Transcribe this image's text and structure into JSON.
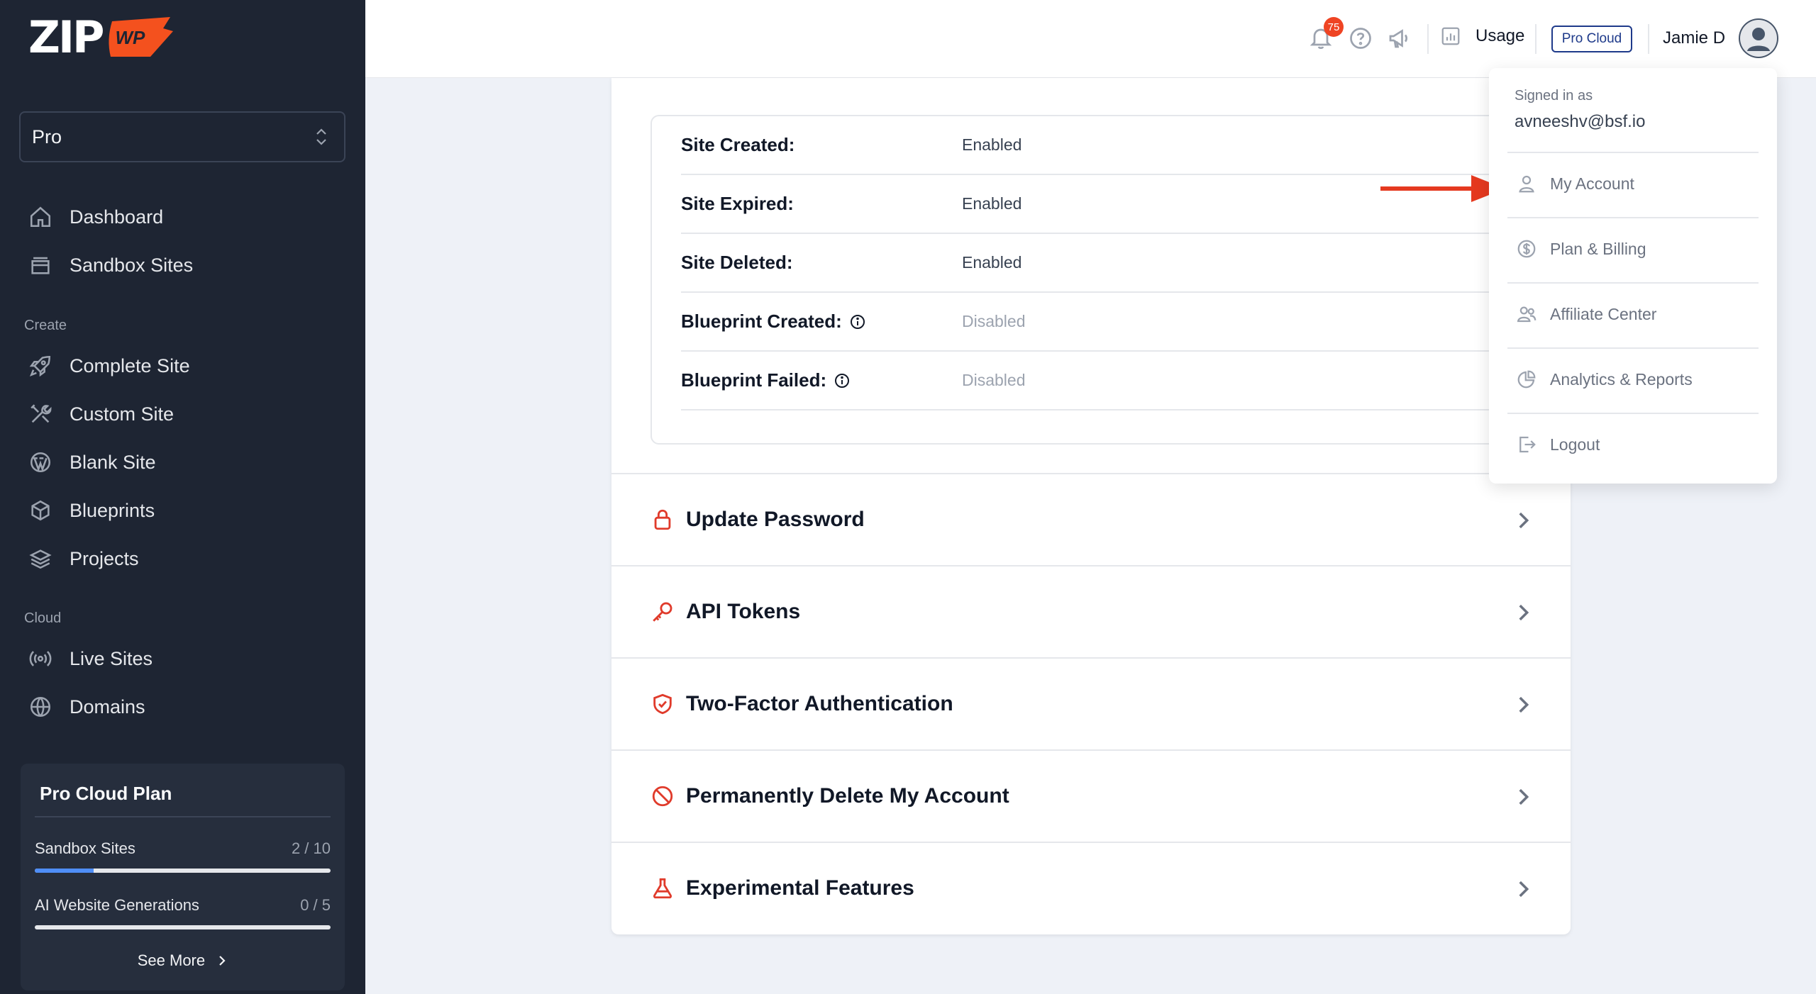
{
  "brand": {
    "logo_text": "ZIP",
    "logo_badge": "WP"
  },
  "sidebar": {
    "plan_select": "Pro",
    "nav_top": [
      {
        "label": "Dashboard",
        "icon": "home-icon"
      },
      {
        "label": "Sandbox Sites",
        "icon": "box-icon"
      }
    ],
    "section_create": "Create",
    "nav_create": [
      {
        "label": "Complete Site",
        "icon": "rocket-icon"
      },
      {
        "label": "Custom Site",
        "icon": "tools-icon"
      },
      {
        "label": "Blank Site",
        "icon": "wordpress-icon"
      },
      {
        "label": "Blueprints",
        "icon": "cube-icon"
      },
      {
        "label": "Projects",
        "icon": "layers-icon"
      }
    ],
    "section_cloud": "Cloud",
    "nav_cloud": [
      {
        "label": "Live Sites",
        "icon": "broadcast-icon"
      },
      {
        "label": "Domains",
        "icon": "globe-icon"
      }
    ],
    "plan_card": {
      "title": "Pro Cloud Plan",
      "usage": [
        {
          "label": "Sandbox Sites",
          "count": "2 / 10",
          "fraction": 0.2
        },
        {
          "label": "AI Website Generations",
          "count": "0 / 5",
          "fraction": 0
        }
      ],
      "see_more": "See More"
    }
  },
  "topbar": {
    "notifications_count": "75",
    "usage_label": "Usage",
    "plan_badge": "Pro Cloud",
    "user_name": "Jamie D"
  },
  "notifications": [
    {
      "label": "Site Created:",
      "value": "Enabled",
      "info": false,
      "enabled": true
    },
    {
      "label": "Site Expired:",
      "value": "Enabled",
      "info": false,
      "enabled": true
    },
    {
      "label": "Site Deleted:",
      "value": "Enabled",
      "info": false,
      "enabled": true
    },
    {
      "label": "Blueprint Created:",
      "value": "Disabled",
      "info": true,
      "enabled": false
    },
    {
      "label": "Blueprint Failed:",
      "value": "Disabled",
      "info": true,
      "enabled": false
    }
  ],
  "sections": [
    {
      "label": "Update Password",
      "icon": "lock-icon"
    },
    {
      "label": "API Tokens",
      "icon": "key-icon"
    },
    {
      "label": "Two-Factor Authentication",
      "icon": "shield-icon"
    },
    {
      "label": "Permanently Delete My Account",
      "icon": "ban-icon"
    },
    {
      "label": "Experimental Features",
      "icon": "flask-icon"
    }
  ],
  "dropdown": {
    "signed_in_label": "Signed in as",
    "email": "avneeshv@bsf.io",
    "items": [
      {
        "label": "My Account",
        "icon": "user-icon"
      },
      {
        "label": "Plan & Billing",
        "icon": "dollar-icon"
      },
      {
        "label": "Affiliate Center",
        "icon": "users-icon"
      },
      {
        "label": "Analytics & Reports",
        "icon": "pie-chart-icon"
      },
      {
        "label": "Logout",
        "icon": "logout-icon"
      }
    ]
  },
  "colors": {
    "sidebar_bg": "#1e2533",
    "accent_red": "#e03b2b",
    "badge_blue": "#1e3a8a",
    "progress_blue": "#4f8ef7"
  }
}
